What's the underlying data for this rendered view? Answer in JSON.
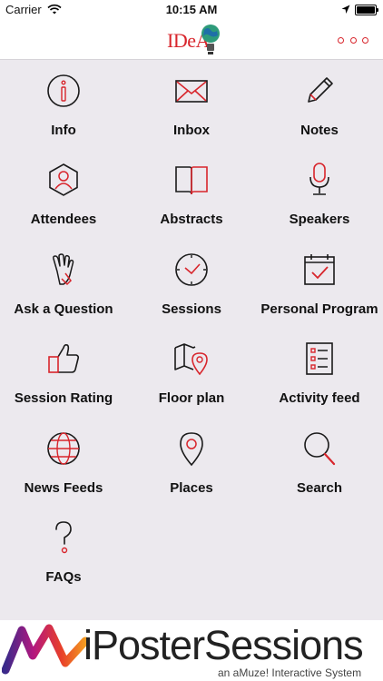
{
  "status_bar": {
    "carrier": "Carrier",
    "time": "10:15 AM"
  },
  "header": {
    "logo_text": "IDeA"
  },
  "menu": [
    {
      "label": "Info",
      "icon": "info-icon"
    },
    {
      "label": "Inbox",
      "icon": "inbox-icon"
    },
    {
      "label": "Notes",
      "icon": "pencil-icon"
    },
    {
      "label": "Attendees",
      "icon": "attendee-icon"
    },
    {
      "label": "Abstracts",
      "icon": "book-icon"
    },
    {
      "label": "Speakers",
      "icon": "microphone-icon"
    },
    {
      "label": "Ask a Question",
      "icon": "raised-hand-icon"
    },
    {
      "label": "Sessions",
      "icon": "clock-icon"
    },
    {
      "label": "Personal Program",
      "icon": "calendar-check-icon"
    },
    {
      "label": "Session Rating",
      "icon": "thumbs-up-icon"
    },
    {
      "label": "Floor plan",
      "icon": "map-pin-icon"
    },
    {
      "label": "Activity feed",
      "icon": "checklist-icon"
    },
    {
      "label": "News Feeds",
      "icon": "globe-icon"
    },
    {
      "label": "Places",
      "icon": "location-pin-icon"
    },
    {
      "label": "Search",
      "icon": "search-icon"
    },
    {
      "label": "FAQs",
      "icon": "question-icon"
    }
  ],
  "banner": {
    "brand": "iPosterSessions",
    "tagline": "an aMuze! Interactive System"
  },
  "colors": {
    "accent": "#d8252c",
    "background": "#ece9ee",
    "icon_stroke": "#1a1a1a"
  }
}
